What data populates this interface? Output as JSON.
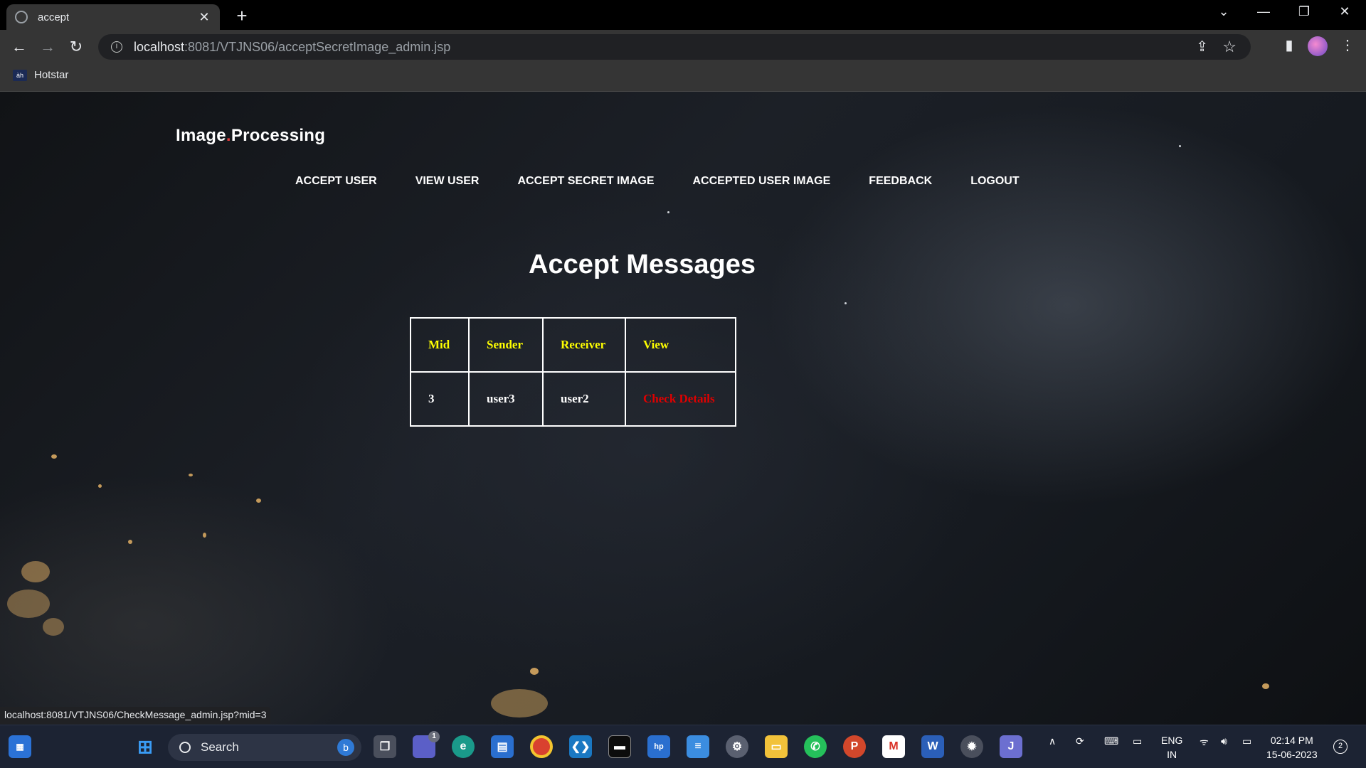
{
  "browser": {
    "tab_title": "accept",
    "url_host": "localhost",
    "url_rest": ":8081/VTJNS06/acceptSecretImage_admin.jsp",
    "bookmark": "Hotstar",
    "bookmark_icon_text": "àh",
    "status_url": "localhost:8081/VTJNS06/CheckMessage_admin.jsp?mid=3"
  },
  "site": {
    "brand_first": "Image",
    "brand_second": "Processing",
    "nav": [
      {
        "label": "ACCEPT USER"
      },
      {
        "label": "VIEW USER"
      },
      {
        "label": "ACCEPT SECRET IMAGE"
      },
      {
        "label": "ACCEPTED USER IMAGE"
      },
      {
        "label": "FEEDBACK"
      },
      {
        "label": "LOGOUT"
      }
    ],
    "heading": "Accept Messages"
  },
  "table": {
    "headers": [
      "Mid",
      "Sender",
      "Receiver",
      "View"
    ],
    "rows": [
      {
        "mid": "3",
        "sender": "user3",
        "receiver": "user2",
        "view": "Check Details"
      }
    ]
  },
  "taskbar": {
    "search_placeholder": "Search",
    "chat_badge": "1",
    "lang_line1": "ENG",
    "lang_line2": "IN",
    "time": "02:14 PM",
    "date": "15-06-2023",
    "notification_count": "2"
  },
  "colors": {
    "header_text": "#ffff00",
    "link_text": "#e00000",
    "brand_dot": "#e23c3c"
  }
}
